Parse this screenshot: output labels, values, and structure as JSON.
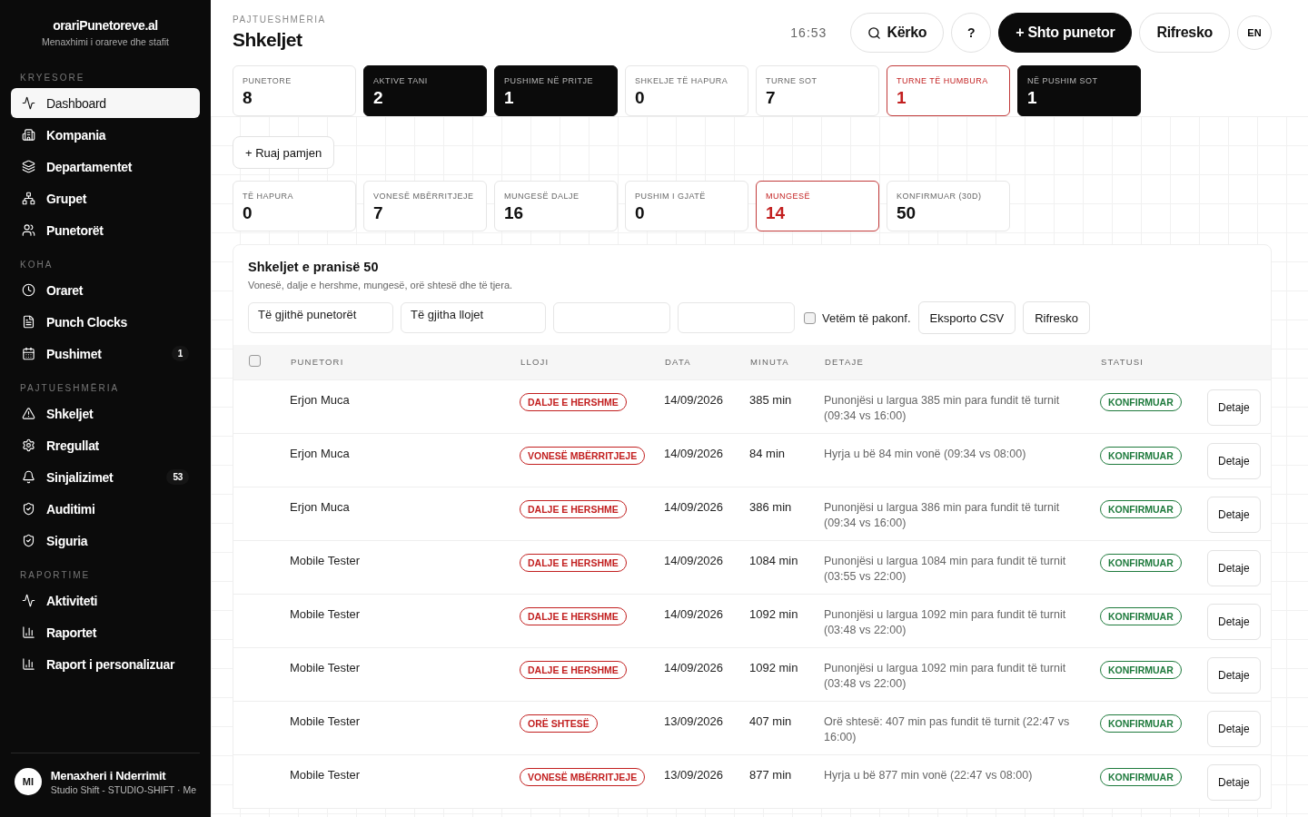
{
  "brand": {
    "name": "orariPunetoreve.al",
    "tagline": "Menaxhimi i orareve dhe stafit"
  },
  "sidebar": {
    "sections": [
      {
        "title": "KRYESORE",
        "items": [
          {
            "label": "Dashboard",
            "selected": true
          },
          {
            "label": "Kompania",
            "selected": false
          },
          {
            "label": "Departamentet",
            "selected": false
          },
          {
            "label": "Grupet",
            "selected": false
          },
          {
            "label": "Punetorët",
            "selected": false
          }
        ]
      },
      {
        "title": "KOHA",
        "items": [
          {
            "label": "Oraret",
            "selected": false
          },
          {
            "label": "Punch Clocks",
            "selected": false
          },
          {
            "label": "Pushimet",
            "selected": false,
            "badge": "1"
          }
        ]
      },
      {
        "title": "PAJTUESHMËRIA",
        "items": [
          {
            "label": "Shkeljet",
            "selected": false
          },
          {
            "label": "Rregullat",
            "selected": false
          },
          {
            "label": "Sinjalizimet",
            "selected": false,
            "badge": "53"
          },
          {
            "label": "Auditimi",
            "selected": false
          },
          {
            "label": "Siguria",
            "selected": false
          }
        ]
      },
      {
        "title": "RAPORTIME",
        "items": [
          {
            "label": "Aktiviteti",
            "selected": false
          },
          {
            "label": "Raportet",
            "selected": false
          },
          {
            "label": "Raport i personalizuar",
            "selected": false
          }
        ]
      }
    ],
    "user": {
      "initials": "MI",
      "name": "Menaxheri i Nderrimit",
      "org": "Studio Shift - STUDIO-SHIFT · Me"
    }
  },
  "header": {
    "breadcrumb": "PAJTUESHMËRIA",
    "title": "Shkeljet",
    "time": "16:53",
    "search": "Kërko",
    "help": "?",
    "primary": "+ Shto punetor",
    "refresh": "Rifresko",
    "language": "EN"
  },
  "stats_top": [
    {
      "label": "PUNETORE",
      "value": "8",
      "kind": "plain"
    },
    {
      "label": "AKTIVE TANI",
      "value": "2",
      "kind": "dark"
    },
    {
      "label": "PUSHIME NË PRITJE",
      "value": "1",
      "kind": "dark"
    },
    {
      "label": "SHKELJE TË HAPURA",
      "value": "0",
      "kind": "plain"
    },
    {
      "label": "TURNE SOT",
      "value": "7",
      "kind": "plain"
    },
    {
      "label": "TURNE TË HUMBURA",
      "value": "1",
      "kind": "alert"
    },
    {
      "label": "NË PUSHIM SOT",
      "value": "1",
      "kind": "dark"
    }
  ],
  "save_view": "+ Ruaj pamjen",
  "stats_filter": [
    {
      "label": "TË HAPURA",
      "value": "0",
      "kind": "plain"
    },
    {
      "label": "VONESË MBËRRITJEJE",
      "value": "7",
      "kind": "plain"
    },
    {
      "label": "MUNGESË DALJE",
      "value": "16",
      "kind": "plain"
    },
    {
      "label": "PUSHIM I GJATË",
      "value": "0",
      "kind": "plain"
    },
    {
      "label": "MUNGESË",
      "value": "14",
      "kind": "alert"
    },
    {
      "label": "KONFIRMUAR (30D)",
      "value": "50",
      "kind": "plain"
    }
  ],
  "panel": {
    "title": "Shkeljet e pranisë 50",
    "subtitle": "Vonesë, dalje e hershme, mungesë, orë shtesë dhe të tjera.",
    "filters": [
      {
        "kind": "select",
        "value": "Të gjithë punetorët"
      },
      {
        "kind": "select",
        "value": "Të gjitha llojet"
      },
      {
        "kind": "date"
      },
      {
        "kind": "date"
      }
    ],
    "unconfirmed_only": {
      "label": "Vetëm të pakonf.",
      "checked": false
    },
    "export": "Eksporto CSV",
    "refresh": "Rifresko",
    "all_selected": false,
    "columns": [
      "PUNETORI",
      "LLOJI",
      "DATA",
      "MINUTA",
      "DETAJE",
      "STATUSI"
    ],
    "rows": [
      {
        "worker": "Erjon Muca",
        "type": "DALJE E HERSHME",
        "date": "14/09/2026",
        "minutes": "385 min",
        "details": "Punonjësi u largua 385 min para fundit të turnit (09:34 vs 16:00)",
        "status": "KONFIRMUAR",
        "action": "Detaje"
      },
      {
        "worker": "Erjon Muca",
        "type": "VONESË MBËRRITJEJE",
        "date": "14/09/2026",
        "minutes": "84 min",
        "details": "Hyrja u bë 84 min vonë (09:34 vs 08:00)",
        "status": "KONFIRMUAR",
        "action": "Detaje"
      },
      {
        "worker": "Erjon Muca",
        "type": "DALJE E HERSHME",
        "date": "14/09/2026",
        "minutes": "386 min",
        "details": "Punonjësi u largua 386 min para fundit të turnit (09:34 vs 16:00)",
        "status": "KONFIRMUAR",
        "action": "Detaje"
      },
      {
        "worker": "Mobile Tester",
        "type": "DALJE E HERSHME",
        "date": "14/09/2026",
        "minutes": "1084 min",
        "details": "Punonjësi u largua 1084 min para fundit të turnit (03:55 vs 22:00)",
        "status": "KONFIRMUAR",
        "action": "Detaje"
      },
      {
        "worker": "Mobile Tester",
        "type": "DALJE E HERSHME",
        "date": "14/09/2026",
        "minutes": "1092 min",
        "details": "Punonjësi u largua 1092 min para fundit të turnit (03:48 vs 22:00)",
        "status": "KONFIRMUAR",
        "action": "Detaje"
      },
      {
        "worker": "Mobile Tester",
        "type": "DALJE E HERSHME",
        "date": "14/09/2026",
        "minutes": "1092 min",
        "details": "Punonjësi u largua 1092 min para fundit të turnit (03:48 vs 22:00)",
        "status": "KONFIRMUAR",
        "action": "Detaje"
      },
      {
        "worker": "Mobile Tester",
        "type": "ORË SHTESË",
        "date": "13/09/2026",
        "minutes": "407 min",
        "details": "Orë shtesë: 407 min pas fundit të turnit (22:47 vs 16:00)",
        "status": "KONFIRMUAR",
        "action": "Detaje"
      },
      {
        "worker": "Mobile Tester",
        "type": "VONESË MBËRRITJEJE",
        "date": "13/09/2026",
        "minutes": "877 min",
        "details": "Hyrja u bë 877 min vonë (22:47 vs 08:00)",
        "status": "KONFIRMUAR",
        "action": "Detaje"
      }
    ]
  }
}
